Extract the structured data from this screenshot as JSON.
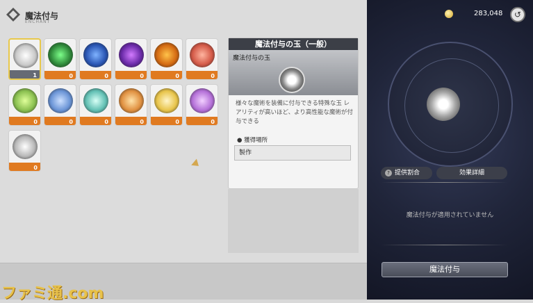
{
  "header": {
    "title": "魔法付与",
    "subtitle": "ENCHANT"
  },
  "items": [
    {
      "count": "1",
      "color": "#c8c8c8",
      "core": "#ffffff"
    },
    {
      "count": "0",
      "color": "#2f8a3a",
      "core": "#7dff8a"
    },
    {
      "count": "0",
      "color": "#2a56b4",
      "core": "#7fb3ff"
    },
    {
      "count": "0",
      "color": "#6a2aa8",
      "core": "#d27bff"
    },
    {
      "count": "0",
      "color": "#d46a12",
      "core": "#ffc34a"
    },
    {
      "count": "0",
      "color": "#d45a48",
      "core": "#ffb5a0"
    },
    {
      "count": "0",
      "color": "#8ac050",
      "core": "#e0ff9a"
    },
    {
      "count": "0",
      "color": "#6a94d6",
      "core": "#cce0ff"
    },
    {
      "count": "0",
      "color": "#62c0b4",
      "core": "#d8fff6"
    },
    {
      "count": "0",
      "color": "#e09040",
      "core": "#ffe2a8"
    },
    {
      "count": "0",
      "color": "#e8c44a",
      "core": "#fff5c8"
    },
    {
      "count": "0",
      "color": "#b470d8",
      "core": "#f2d0ff"
    },
    {
      "count": "0",
      "color": "#b8b8b8",
      "core": "#ffffff"
    }
  ],
  "panel": {
    "title": "魔法付与の玉（一般）",
    "subtitle": "魔法付与の玉",
    "description": "様々な魔術を装備に付与できる特殊な玉 レアリティが高いほど、より高性能な魔術が付与できる",
    "location_label": "獲得場所",
    "location_value": "製作"
  },
  "right": {
    "coins": "283,048",
    "tab_rate": "提供割合",
    "tab_effect": "効果詳細",
    "status": "魔法付与が適用されていません",
    "button": "魔法付与"
  },
  "watermark": "ファミ通.com"
}
